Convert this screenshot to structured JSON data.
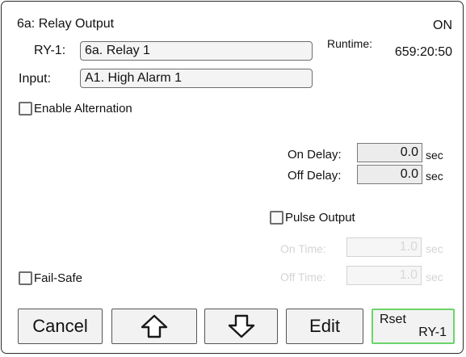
{
  "screen": {
    "title": "6a: Relay Output",
    "state": "ON",
    "relay": {
      "label": "RY-1:",
      "value": "6a. Relay 1"
    },
    "input": {
      "label": "Input:",
      "value": "A1. High Alarm 1"
    },
    "runtime": {
      "label": "Runtime:",
      "value": "659:20:50"
    }
  },
  "options": {
    "enable_alternation": {
      "label": "Enable Alternation",
      "checked": false
    },
    "pulse_output": {
      "label": "Pulse Output",
      "checked": false
    },
    "fail_safe": {
      "label": "Fail-Safe",
      "checked": false
    }
  },
  "delays": {
    "on": {
      "label": "On Delay:",
      "value": "0.0",
      "unit": "sec"
    },
    "off": {
      "label": "Off Delay:",
      "value": "0.0",
      "unit": "sec"
    }
  },
  "pulse": {
    "on_time": {
      "label": "On Time:",
      "value": "1.0",
      "unit": "sec",
      "enabled": false
    },
    "off_time": {
      "label": "Off Time:",
      "value": "1.0",
      "unit": "sec",
      "enabled": false
    }
  },
  "buttons": {
    "cancel": "Cancel",
    "up_icon": "arrow-up-icon",
    "down_icon": "arrow-down-icon",
    "edit": "Edit",
    "rset_line1": "Rset",
    "rset_line2": "RY-1"
  },
  "colors": {
    "rset_border": "#6bd46b",
    "disabled_text": "#d4d4d4"
  }
}
